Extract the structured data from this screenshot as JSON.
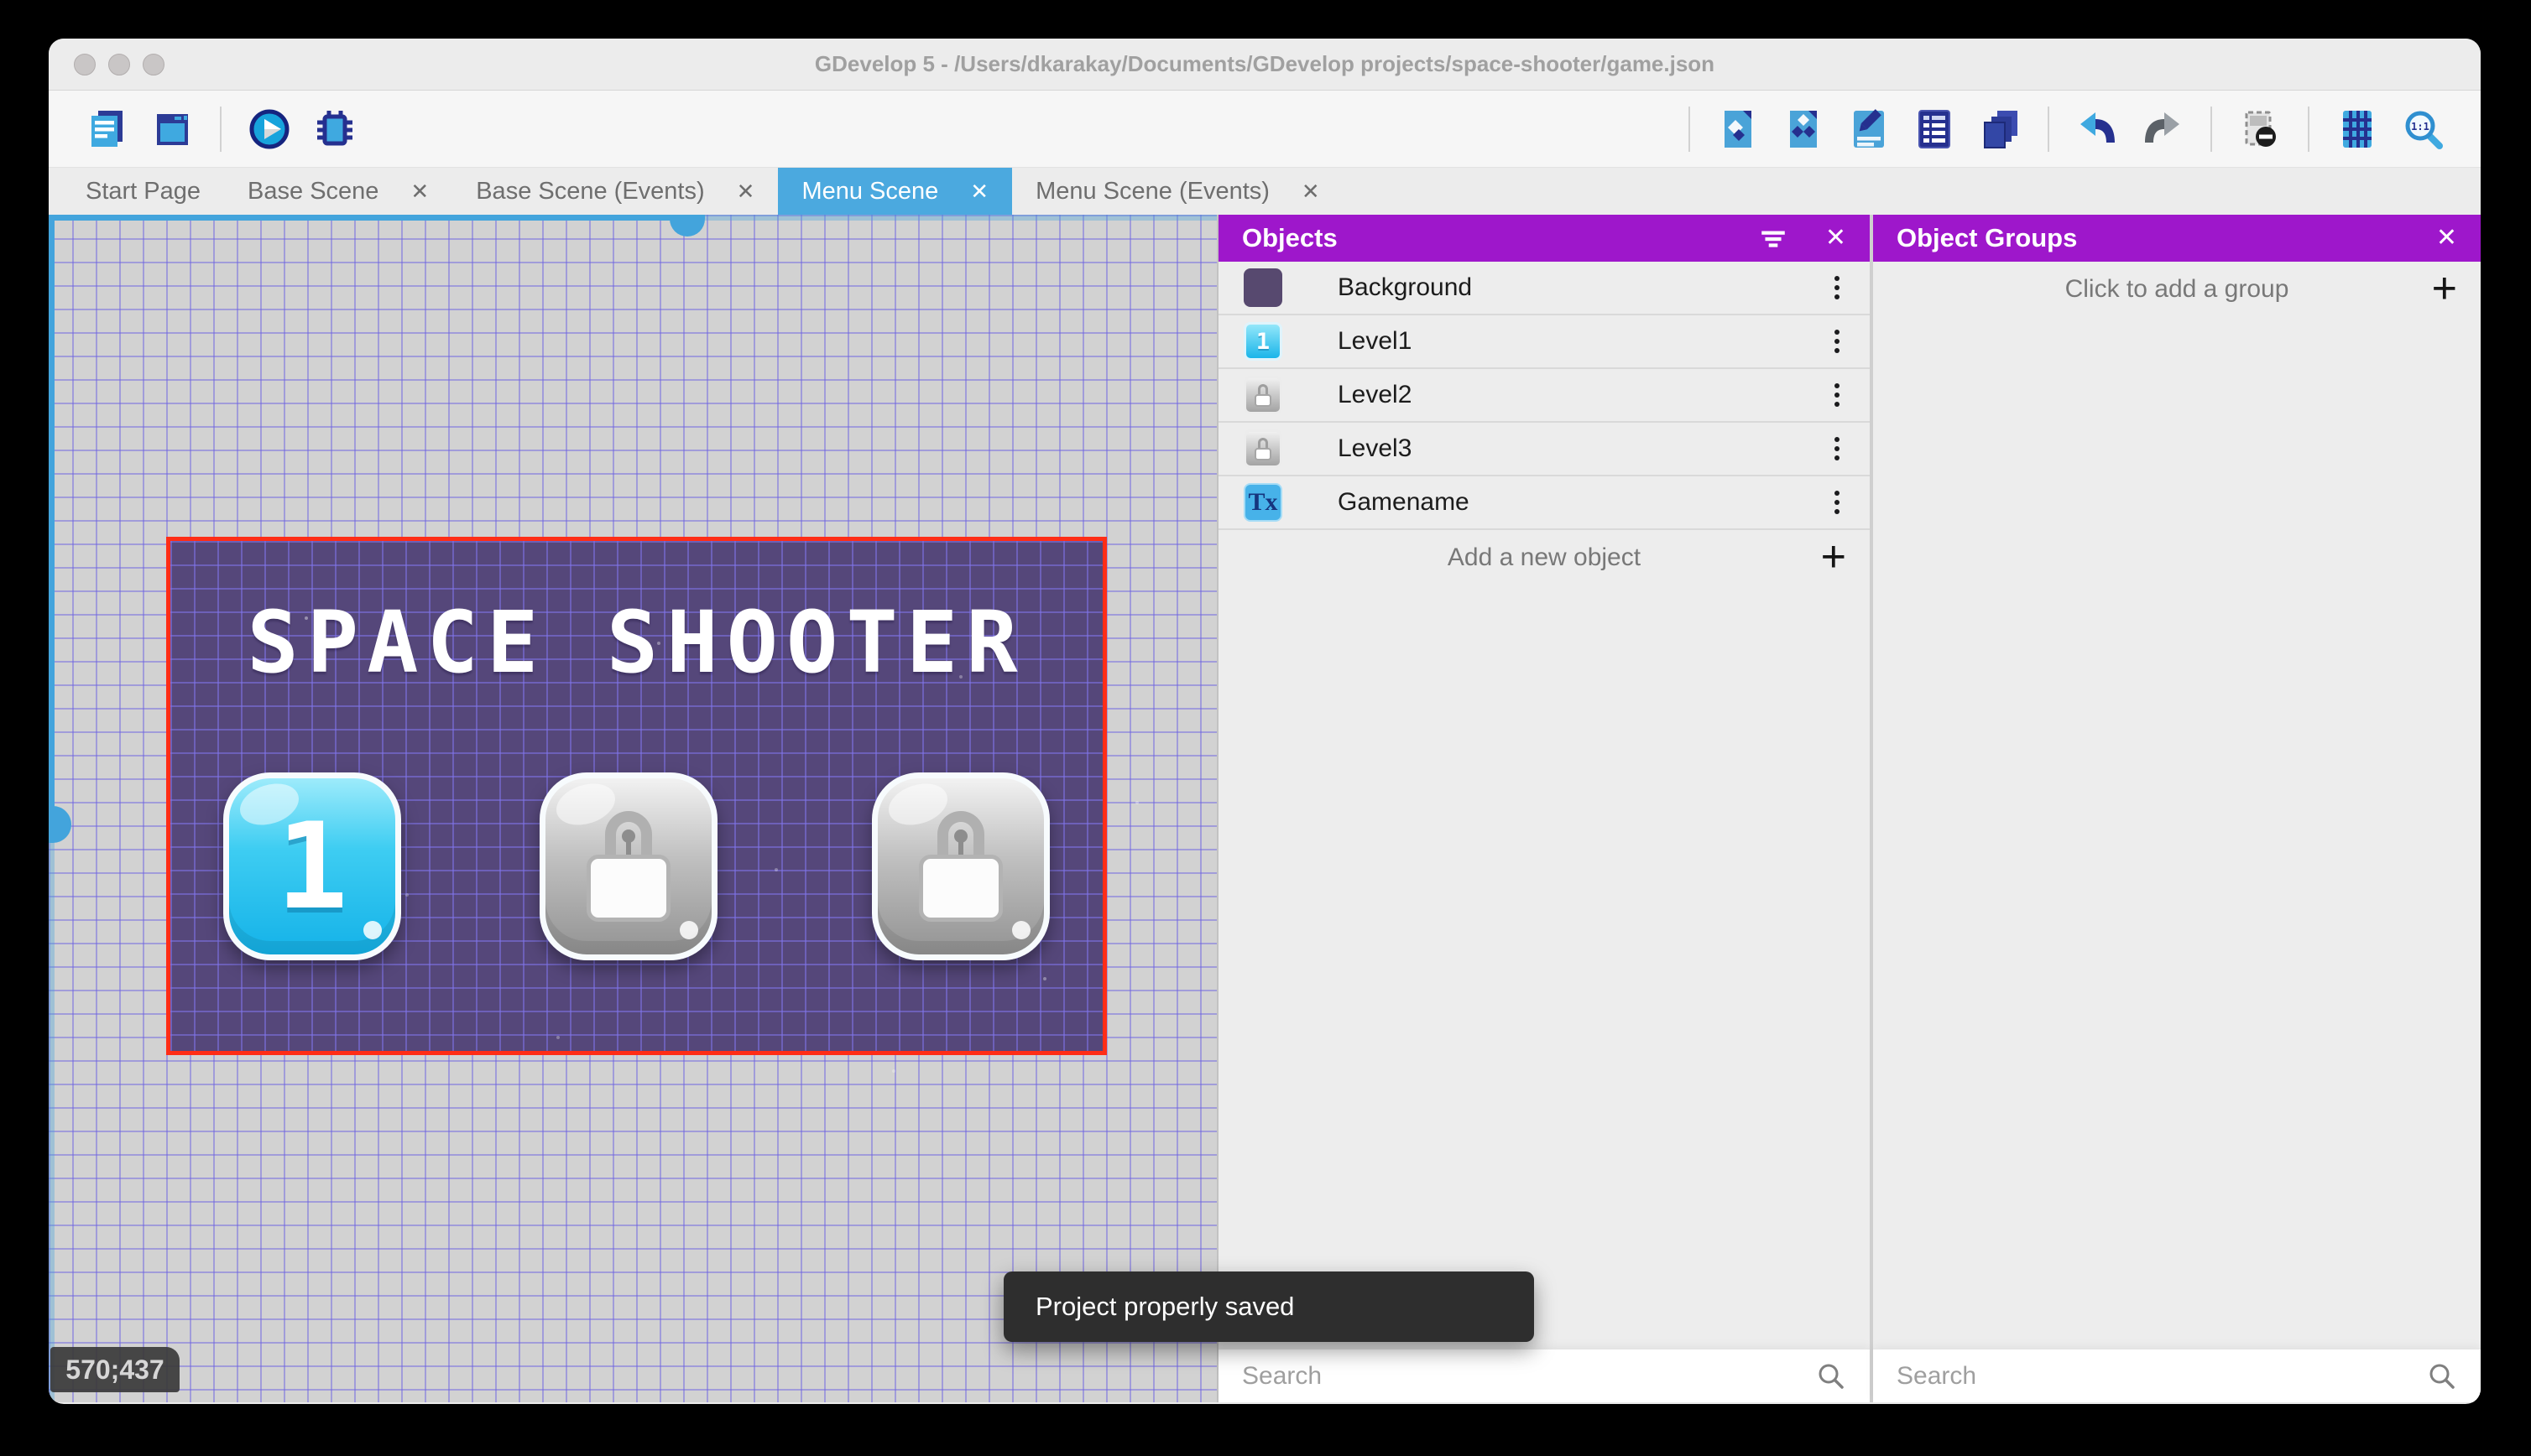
{
  "window": {
    "title": "GDevelop 5 - /Users/dkarakay/Documents/GDevelop projects/space-shooter/game.json"
  },
  "glyphs": {
    "close": "✕",
    "plus": "+"
  },
  "toolbar": {
    "left_icons": [
      "project-manager-icon",
      "scene-window-icon",
      "play-preview-icon",
      "debug-icon"
    ],
    "right_icons": [
      "objects-panel-icon",
      "object-groups-panel-icon",
      "properties-panel-icon",
      "instances-list-icon",
      "layers-panel-icon",
      "undo-icon",
      "redo-icon",
      "window-mask-icon",
      "grid-icon",
      "zoom-1-1-icon"
    ]
  },
  "tabs": [
    {
      "label": "Start Page",
      "active": false,
      "closable": false
    },
    {
      "label": "Base Scene",
      "active": false,
      "closable": true
    },
    {
      "label": "Base Scene (Events)",
      "active": false,
      "closable": true
    },
    {
      "label": "Menu Scene",
      "active": true,
      "closable": true
    },
    {
      "label": "Menu Scene (Events)",
      "active": false,
      "closable": true
    }
  ],
  "canvas": {
    "coordinates": "570;437",
    "scene": {
      "title": "SPACE SHOOTER",
      "buttons": [
        {
          "type": "level",
          "label": "1"
        },
        {
          "type": "locked",
          "label": ""
        },
        {
          "type": "locked",
          "label": ""
        }
      ]
    }
  },
  "panels": {
    "objects": {
      "title": "Objects",
      "items": [
        {
          "label": "Background",
          "thumb": "purple-square",
          "badge": ""
        },
        {
          "label": "Level1",
          "thumb": "blue-button",
          "badge": "1"
        },
        {
          "label": "Level2",
          "thumb": "locked-button",
          "badge": ""
        },
        {
          "label": "Level3",
          "thumb": "locked-button",
          "badge": ""
        },
        {
          "label": "Gamename",
          "thumb": "text-object",
          "badge": "Tx"
        }
      ],
      "add_label": "Add a new object",
      "search_placeholder": "Search"
    },
    "object_groups": {
      "title": "Object Groups",
      "empty_label": "Click to add a group",
      "search_placeholder": "Search"
    }
  },
  "toast": {
    "message": "Project properly saved"
  },
  "colors": {
    "accent-purple": "#9e17cb",
    "tab-blue": "#4ba9df",
    "selection-red": "#ff2d16",
    "scene-bg": "#55477a",
    "toast-bg": "#2e2e2e",
    "scroll-blue": "#43a4dc"
  }
}
